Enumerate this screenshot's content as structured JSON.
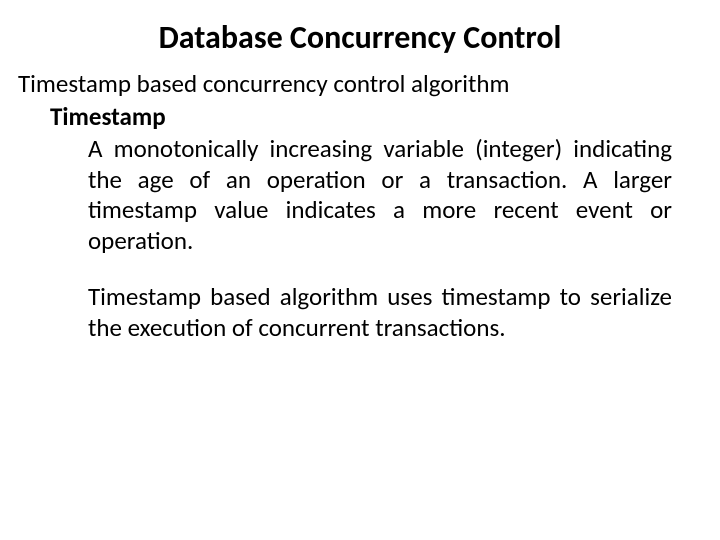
{
  "slide": {
    "title": "Database Concurrency Control",
    "subtitle": "Timestamp based concurrency control algorithm",
    "term": "Timestamp",
    "definition": "A monotonically increasing variable (integer) indicating the age of an operation or a transaction.  A larger timestamp value indicates a more recent event or operation.",
    "explanation": "Timestamp based algorithm uses timestamp to serialize the execution of concurrent transactions."
  }
}
